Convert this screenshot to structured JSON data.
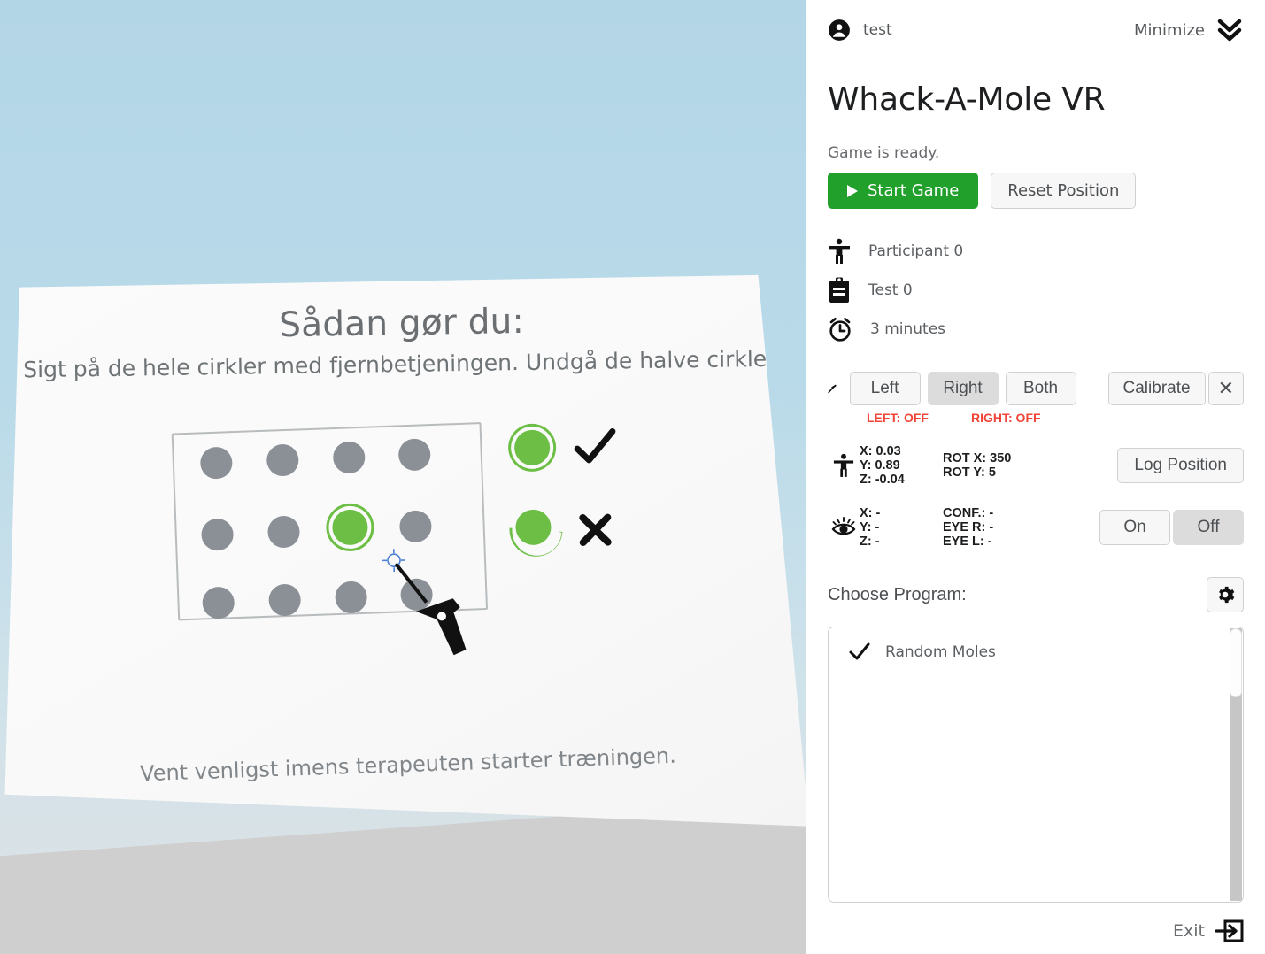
{
  "panel": {
    "topbar": {
      "user_icon": "account-circle-icon",
      "user_name": "test",
      "minimize_label": "Minimize",
      "minimize_icon": "double-chevron-down-icon"
    },
    "app_title": "Whack-A-Mole VR",
    "status_text": "Game is ready.",
    "start_button": "Start Game",
    "reset_button": "Reset Position",
    "info_rows": [
      {
        "icon": "accessibility-person-icon",
        "text": "Participant 0"
      },
      {
        "icon": "clipboard-icon",
        "text": "Test 0"
      },
      {
        "icon": "alarm-clock-icon",
        "text": "3 minutes"
      }
    ],
    "hand_control": {
      "icon": "hammer-icon",
      "options": [
        "Left",
        "Right",
        "Both"
      ],
      "selected": "Right",
      "calibrate_label": "Calibrate",
      "close_icon": "close-x-icon",
      "left_status": "LEFT: OFF",
      "right_status": "RIGHT: OFF",
      "status_color": "#f04438"
    },
    "position_tracking": {
      "icon": "accessibility-person-icon",
      "x": "X: 0.03",
      "y": "Y: 0.89",
      "z": "Z: -0.04",
      "rot_x": "ROT X: 350",
      "rot_y": "ROT Y: 5",
      "log_button": "Log Position"
    },
    "eye_tracking": {
      "icon": "eye-icon",
      "x": "X: -",
      "y": "Y: -",
      "z": "Z: -",
      "conf": "CONF.: -",
      "eye_r": "EYE R: -",
      "eye_l": "EYE L: -",
      "on_label": "On",
      "off_label": "Off",
      "selected": "Off"
    },
    "program": {
      "label": "Choose Program:",
      "gear_icon": "gear-icon",
      "items": [
        {
          "name": "Random Moles",
          "checked": true,
          "check_icon": "check-icon"
        }
      ]
    },
    "footer": {
      "exit_label": "Exit",
      "exit_icon": "exit-arrow-icon"
    },
    "colors": {
      "accent_green": "#22a02c",
      "mole_green": "#6cbe45",
      "status_red": "#f04438",
      "selected_gray": "#dcdcdc"
    }
  },
  "vr_scene": {
    "sky_color": "#b6d8e8",
    "floor_color": "#cfcfcf",
    "board_color": "#fafafa",
    "title": "Sådan gør du:",
    "subtitle": "Sigt på de hele cirkler med fjernbetjeningen. Undgå de halve cirkler.",
    "footer_text": "Vent venligst imens terapeuten starter træningen.",
    "diagram": {
      "grid_rows": 3,
      "grid_cols": 4,
      "inactive_mole_color": "#8b9097",
      "active_mole_color": "#6cbe45",
      "active_mole_position": {
        "row": 2,
        "col": 3
      },
      "crosshair_icon": "crosshair-icon",
      "hammer_icon": "hammer-icon",
      "legend": [
        {
          "shape": "full-circle",
          "marker": "check-icon"
        },
        {
          "shape": "half-circle",
          "marker": "cross-icon"
        }
      ]
    }
  }
}
